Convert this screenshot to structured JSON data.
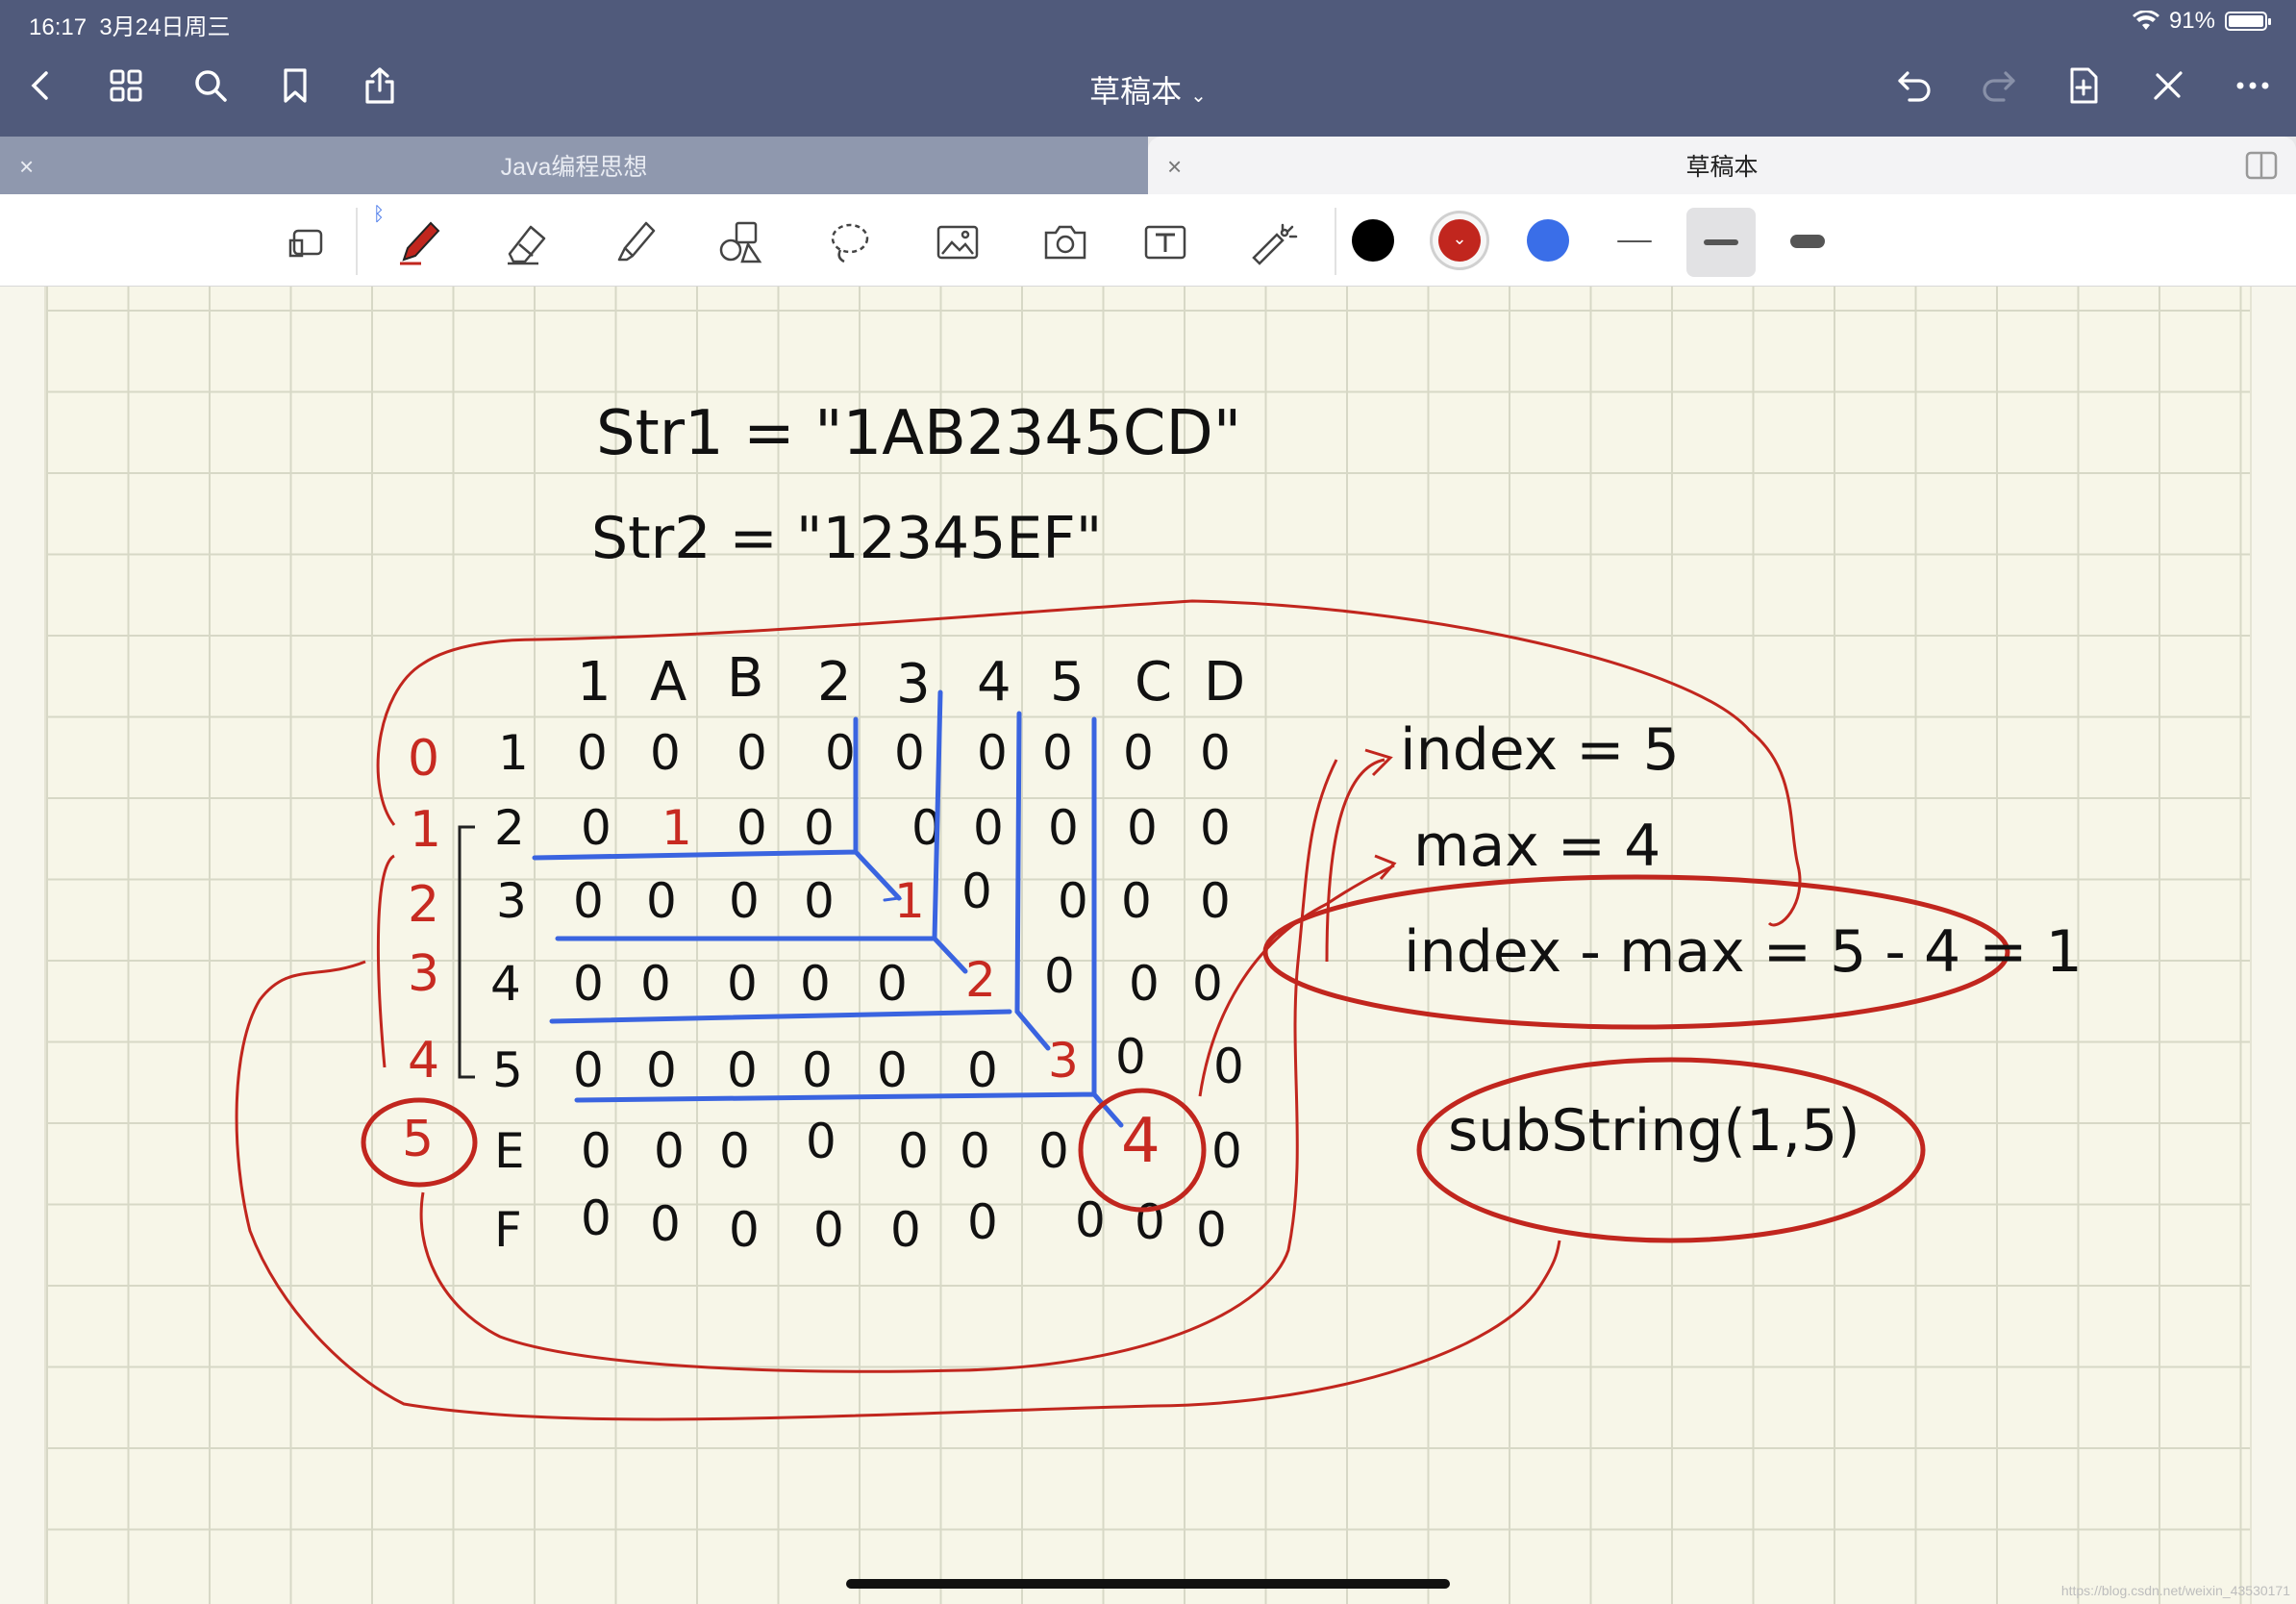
{
  "status": {
    "time": "16:17",
    "date": "3月24日周三",
    "battery": "91%"
  },
  "nav": {
    "title": "草稿本",
    "icons": [
      "back-icon",
      "grid-icon",
      "search-icon",
      "bookmark-icon",
      "share-icon",
      "undo-icon",
      "redo-icon",
      "add-page-icon",
      "close-pen-icon",
      "more-icon"
    ]
  },
  "tabs": [
    {
      "label": "Java编程思想",
      "close": "×"
    },
    {
      "label": "草稿本",
      "close": "×"
    }
  ],
  "toolbar": {
    "tools": [
      "lasso-scan-icon",
      "pen-icon",
      "eraser-icon",
      "highlighter-icon",
      "shapes-icon",
      "lasso-icon",
      "image-icon",
      "camera-icon",
      "text-icon",
      "laser-pointer-icon"
    ],
    "colors": [
      "#000000",
      "#c1261e",
      "#3a6ee8"
    ],
    "selected_color": "#c1261e",
    "selected_stroke_index": 1
  },
  "note": {
    "str1": "Str1 = \"1AB2345CD\"",
    "str2": "Str2 = \"12345EF\"",
    "col_headers": [
      "1",
      "A",
      "B",
      "2",
      "3",
      "4",
      "5",
      "C",
      "D"
    ],
    "row_headers": [
      "1",
      "2",
      "3",
      "4",
      "5",
      "E",
      "F"
    ],
    "row_indices": [
      "0",
      "1",
      "2",
      "3",
      "4",
      "5"
    ],
    "matrix": [
      [
        "1",
        "0",
        "0",
        "0",
        "0",
        "0",
        "0",
        "0",
        "0",
        "0"
      ],
      [
        "2",
        "0",
        "1",
        "0",
        "0",
        "0",
        "0",
        "0",
        "0",
        "0"
      ],
      [
        "3",
        "0",
        "0",
        "0",
        "0",
        "1",
        "0",
        "0",
        "0",
        "0"
      ],
      [
        "4",
        "0",
        "0",
        "0",
        "0",
        "0",
        "2",
        "0",
        "0",
        "0"
      ],
      [
        "5",
        "0",
        "0",
        "0",
        "0",
        "0",
        "0",
        "3",
        "0",
        "0"
      ],
      [
        "E",
        "0",
        "0",
        "0",
        "0",
        "0",
        "0",
        "0",
        "4",
        "0"
      ],
      [
        "F",
        "0",
        "0",
        "0",
        "0",
        "0",
        "0",
        "0",
        "0",
        "0"
      ]
    ],
    "index_text": "index = 5",
    "max_text": "max = 4",
    "calc_text": "index - max = 5 - 4 = 1",
    "substring_text": "subString(1,5)"
  },
  "watermark": "https://blog.csdn.net/weixin_43530171"
}
